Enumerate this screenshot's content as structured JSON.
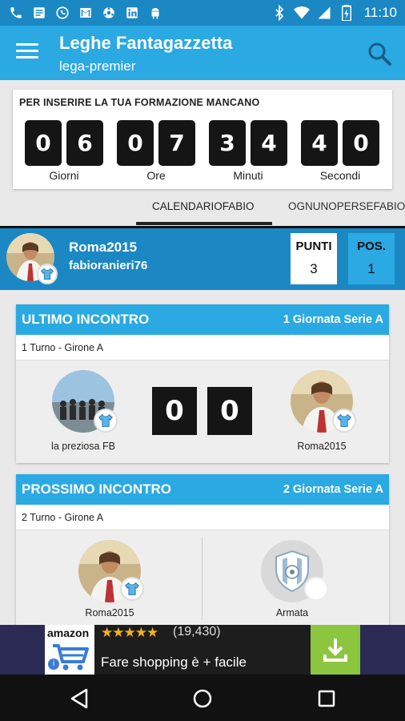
{
  "status_bar": {
    "time": "11:10",
    "left_icons": [
      "phone-icon",
      "message-icon",
      "whatsapp-icon",
      "gmail-icon",
      "ball-icon",
      "linkedin-icon",
      "android-icon"
    ],
    "right_icons": [
      "bluetooth-icon",
      "wifi-icon",
      "signal-icon",
      "battery-icon"
    ]
  },
  "appbar": {
    "title": "Leghe Fantagazzetta",
    "subtitle": "lega-premier"
  },
  "countdown": {
    "title": "PER INSERIRE LA TUA FORMAZIONE MANCANO",
    "groups": [
      {
        "d1": "0",
        "d2": "6",
        "label": "Giorni"
      },
      {
        "d1": "0",
        "d2": "7",
        "label": "Ore"
      },
      {
        "d1": "3",
        "d2": "4",
        "label": "Minuti"
      },
      {
        "d1": "4",
        "d2": "0",
        "label": "Secondi"
      }
    ]
  },
  "tabs": [
    {
      "label": "CALENDARIOFABIO",
      "active": true
    },
    {
      "label": "OGNUNOPERSEFABIO",
      "active": false
    }
  ],
  "team": {
    "name": "Roma2015",
    "user": "fabioranieri76",
    "punti_label": "PUNTI",
    "punti": "3",
    "pos_label": "POS.",
    "pos": "1"
  },
  "last_match": {
    "header": "ULTIMO INCONTRO",
    "round": "1 Giornata Serie A",
    "sub": "1 Turno - Girone A",
    "home": "la preziosa FB",
    "away": "Roma2015",
    "home_score": "0",
    "away_score": "0"
  },
  "next_match": {
    "header": "PROSSIMO INCONTRO",
    "round": "2 Giornata Serie A",
    "sub": "2 Turno - Girone A",
    "home": "Roma2015",
    "away": "Armata"
  },
  "ad": {
    "brand": "amazon",
    "rating_stars": "★★★★★",
    "reviews": "(19,430)",
    "text": "Fare shopping è + facile"
  },
  "colors": {
    "primary": "#2aa9e3",
    "primary_dark": "#1b88c4",
    "digit_bg": "#151515",
    "ad_green": "#8cc63f"
  }
}
